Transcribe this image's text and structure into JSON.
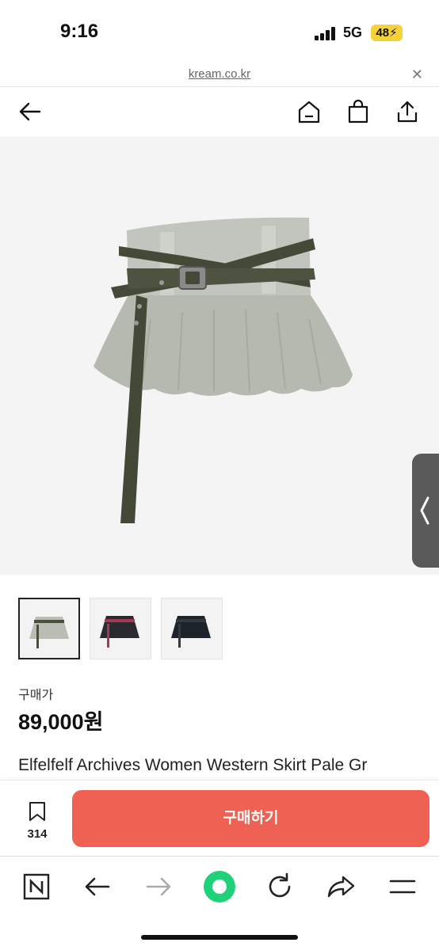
{
  "status_bar": {
    "time": "9:16",
    "network": "5G",
    "battery": "48"
  },
  "url_bar": {
    "domain": "kream.co.kr"
  },
  "header": {
    "icons": [
      "back-arrow-icon",
      "home-icon",
      "shopping-bag-icon",
      "share-icon"
    ]
  },
  "product": {
    "price_label": "구매가",
    "price": "89,000원",
    "title": "Elfelfelf Archives Women Western Skirt Pale Gr",
    "thumbnails": [
      {
        "color": "#b9bdb3",
        "belt": "#4a4f3c",
        "selected": true
      },
      {
        "color": "#2a2a30",
        "belt": "#a23a55",
        "selected": false
      },
      {
        "color": "#1e242b",
        "belt": "#333a40",
        "selected": false
      }
    ]
  },
  "buy_bar": {
    "wish_count": "314",
    "buy_label": "구매하기"
  },
  "browser_toolbar": {
    "items": [
      "naver-icon",
      "back-icon",
      "forward-icon",
      "green-dot-icon",
      "reload-icon",
      "share-icon",
      "menu-icon"
    ]
  },
  "colors": {
    "accent": "#ef6253",
    "green": "#1fd27a"
  }
}
